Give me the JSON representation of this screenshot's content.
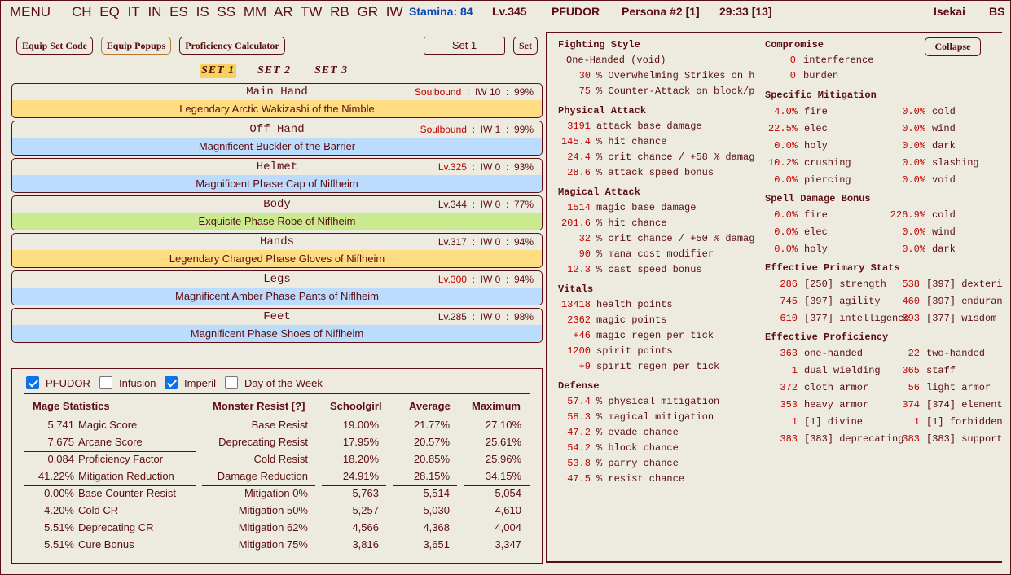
{
  "topbar": {
    "menu": "MENU",
    "nav": [
      "CH",
      "EQ",
      "IT",
      "IN",
      "ES",
      "IS",
      "SS",
      "MM",
      "AR",
      "TW",
      "RB",
      "GR",
      "IW"
    ],
    "stamina": "Stamina: 84",
    "level": "Lv.345",
    "name": "PFUDOR",
    "persona": "Persona #2 [1]",
    "time": "29:33 [13]",
    "world": "Isekai",
    "bs": "BS"
  },
  "toolbar": {
    "equip_set_code": "Equip Set Code",
    "equip_popups": "Equip Popups",
    "proficiency_calculator": "Proficiency Calculator",
    "set_name_value": "Set 1",
    "set_button": "Set"
  },
  "set_tabs": [
    "SET 1",
    "SET 2",
    "SET 3"
  ],
  "slots": [
    {
      "slot": "Main Hand",
      "bind": "Soulbound",
      "iw": "IW 10",
      "cond": "99%",
      "item": "Legendary Arctic Wakizashi of the Nimble",
      "tier": "gold"
    },
    {
      "slot": "Off Hand",
      "bind": "Soulbound",
      "iw": "IW 1",
      "cond": "99%",
      "item": "Magnificent Buckler of the Barrier",
      "tier": "blue"
    },
    {
      "slot": "Helmet",
      "bind": "Lv.325",
      "iw": "IW 0",
      "cond": "93%",
      "item": "Magnificent Phase Cap of Niflheim",
      "tier": "blue"
    },
    {
      "slot": "Body",
      "bind": "Lv.344",
      "iw": "IW 0",
      "cond": "77%",
      "item": "Exquisite Phase Robe of Niflheim",
      "tier": "green"
    },
    {
      "slot": "Hands",
      "bind": "Lv.317",
      "iw": "IW 0",
      "cond": "94%",
      "item": "Legendary Charged Phase Gloves of Niflheim",
      "tier": "gold"
    },
    {
      "slot": "Legs",
      "bind": "Lv.300",
      "iw": "IW 0",
      "cond": "94%",
      "item": "Magnificent Amber Phase Pants of Niflheim",
      "tier": "blue"
    },
    {
      "slot": "Feet",
      "bind": "Lv.285",
      "iw": "IW 0",
      "cond": "98%",
      "item": "Magnificent Phase Shoes of Niflheim",
      "tier": "blue"
    }
  ],
  "filters": [
    {
      "label": "PFUDOR",
      "checked": true
    },
    {
      "label": "Infusion",
      "checked": false
    },
    {
      "label": "Imperil",
      "checked": true
    },
    {
      "label": "Day of the Week",
      "checked": false
    }
  ],
  "mage_stats": {
    "headers": [
      "Mage Statistics",
      "Monster Resist [?]",
      "Schoolgirl",
      "Average",
      "Maximum"
    ],
    "left": [
      {
        "value": "5,741",
        "label": "Magic Score"
      },
      {
        "value": "7,675",
        "label": "Arcane Score"
      },
      {
        "value": "0.084",
        "label": "Proficiency Factor"
      },
      {
        "value": "41.22%",
        "label": "Mitigation Reduction"
      },
      {
        "value": "0.00%",
        "label": "Base Counter-Resist"
      },
      {
        "value": "4.20%",
        "label": "Cold CR"
      },
      {
        "value": "5.51%",
        "label": "Deprecating CR"
      },
      {
        "value": "5.51%",
        "label": "Cure Bonus"
      }
    ],
    "right": [
      {
        "label": "Base Resist",
        "a": "19.00%",
        "b": "21.77%",
        "c": "27.10%"
      },
      {
        "label": "Deprecating Resist",
        "a": "17.95%",
        "b": "20.57%",
        "c": "25.61%"
      },
      {
        "label": "Cold Resist",
        "a": "18.20%",
        "b": "20.85%",
        "c": "25.96%"
      },
      {
        "label": "Damage Reduction",
        "a": "24.91%",
        "b": "28.15%",
        "c": "34.15%"
      },
      {
        "label": "Mitigation 0%",
        "a": "5,763",
        "b": "5,514",
        "c": "5,054"
      },
      {
        "label": "Mitigation 50%",
        "a": "5,257",
        "b": "5,030",
        "c": "4,610"
      },
      {
        "label": "Mitigation 62%",
        "a": "4,566",
        "b": "4,368",
        "c": "4,004"
      },
      {
        "label": "Mitigation 75%",
        "a": "3,816",
        "b": "3,651",
        "c": "3,347"
      }
    ]
  },
  "left_col": {
    "fighting_style": {
      "title": "Fighting Style",
      "name": "One-Handed (void)",
      "lines": [
        {
          "v": "30",
          "t": "% Overwhelming Strikes on h"
        },
        {
          "v": "75",
          "t": "% Counter-Attack on block/p"
        }
      ]
    },
    "physical": {
      "title": "Physical Attack",
      "lines": [
        {
          "v": "3191",
          "t": "attack base damage"
        },
        {
          "v": "145.4",
          "t": "% hit chance"
        },
        {
          "v": "24.4",
          "t": "% crit chance / +58 % damag"
        },
        {
          "v": "28.6",
          "t": "% attack speed bonus"
        }
      ]
    },
    "magical": {
      "title": "Magical Attack",
      "lines": [
        {
          "v": "1514",
          "t": "magic base damage"
        },
        {
          "v": "201.6",
          "t": "% hit chance"
        },
        {
          "v": "32",
          "t": "% crit chance / +50 % damag"
        },
        {
          "v": "90",
          "t": "% mana cost modifier"
        },
        {
          "v": "12.3",
          "t": "% cast speed bonus"
        }
      ]
    },
    "vitals": {
      "title": "Vitals",
      "lines": [
        {
          "v": "13418",
          "t": "health points"
        },
        {
          "v": "2362",
          "t": "magic points"
        },
        {
          "v": "+46",
          "t": "magic regen per tick"
        },
        {
          "v": "1200",
          "t": "spirit points"
        },
        {
          "v": "+9",
          "t": "spirit regen per tick"
        }
      ]
    },
    "defense": {
      "title": "Defense",
      "lines": [
        {
          "v": "57.4",
          "t": "% physical mitigation"
        },
        {
          "v": "58.3",
          "t": "% magical mitigation"
        },
        {
          "v": "47.2",
          "t": "% evade chance"
        },
        {
          "v": "54.2",
          "t": "% block chance"
        },
        {
          "v": "53.8",
          "t": "% parry chance"
        },
        {
          "v": "47.5",
          "t": "% resist chance"
        }
      ]
    }
  },
  "right_col": {
    "collapse": "Collapse",
    "compromise": {
      "title": "Compromise",
      "lines": [
        {
          "v": "0",
          "t": "interference"
        },
        {
          "v": "0",
          "t": "burden"
        }
      ]
    },
    "specific_mitigation": {
      "title": "Specific Mitigation",
      "rows": [
        {
          "v1": "4.0%",
          "t1": "fire",
          "v2": "0.0%",
          "t2": "cold"
        },
        {
          "v1": "22.5%",
          "t1": "elec",
          "v2": "0.0%",
          "t2": "wind"
        },
        {
          "v1": "0.0%",
          "t1": "holy",
          "v2": "0.0%",
          "t2": "dark"
        },
        {
          "v1": "10.2%",
          "t1": "crushing",
          "v2": "0.0%",
          "t2": "slashing"
        },
        {
          "v1": "0.0%",
          "t1": "piercing",
          "v2": "0.0%",
          "t2": "void"
        }
      ]
    },
    "spell_damage": {
      "title": "Spell Damage Bonus",
      "rows": [
        {
          "v1": "0.0%",
          "t1": "fire",
          "v2": "226.9%",
          "t2": "cold"
        },
        {
          "v1": "0.0%",
          "t1": "elec",
          "v2": "0.0%",
          "t2": "wind"
        },
        {
          "v1": "0.0%",
          "t1": "holy",
          "v2": "0.0%",
          "t2": "dark"
        }
      ]
    },
    "primary": {
      "title": "Effective Primary Stats",
      "rows": [
        {
          "v1": "286",
          "t1": "[250] strength",
          "v2": "538",
          "t2": "[397] dexteri"
        },
        {
          "v1": "745",
          "t1": "[397] agility",
          "v2": "460",
          "t2": "[397] enduran"
        },
        {
          "v1": "610",
          "t1": "[377] intelligence",
          "v2": "893",
          "t2": "[377] wisdom"
        }
      ]
    },
    "proficiency": {
      "title": "Effective Proficiency",
      "rows": [
        {
          "v1": "363",
          "t1": "one-handed",
          "v2": "22",
          "t2": "two-handed"
        },
        {
          "v1": "1",
          "t1": "dual wielding",
          "v2": "365",
          "t2": "staff"
        },
        {
          "v1": "372",
          "t1": "cloth armor",
          "v2": "56",
          "t2": "light armor"
        },
        {
          "v1": "353",
          "t1": "heavy armor",
          "v2": "374",
          "t2": "[374] element"
        },
        {
          "v1": "1",
          "t1": "[1] divine",
          "v2": "1",
          "t2": "[1] forbidden"
        },
        {
          "v1": "383",
          "t1": "[383] deprecating",
          "v2": "383",
          "t2": "[383] support"
        }
      ]
    }
  },
  "colors": {
    "text": "#5c0d11",
    "value": "#c20000",
    "stamina": "#0a46b4",
    "legendary": "#fedc82",
    "magnificent": "#bcdcfe",
    "exquisite": "#c9ea8f"
  }
}
